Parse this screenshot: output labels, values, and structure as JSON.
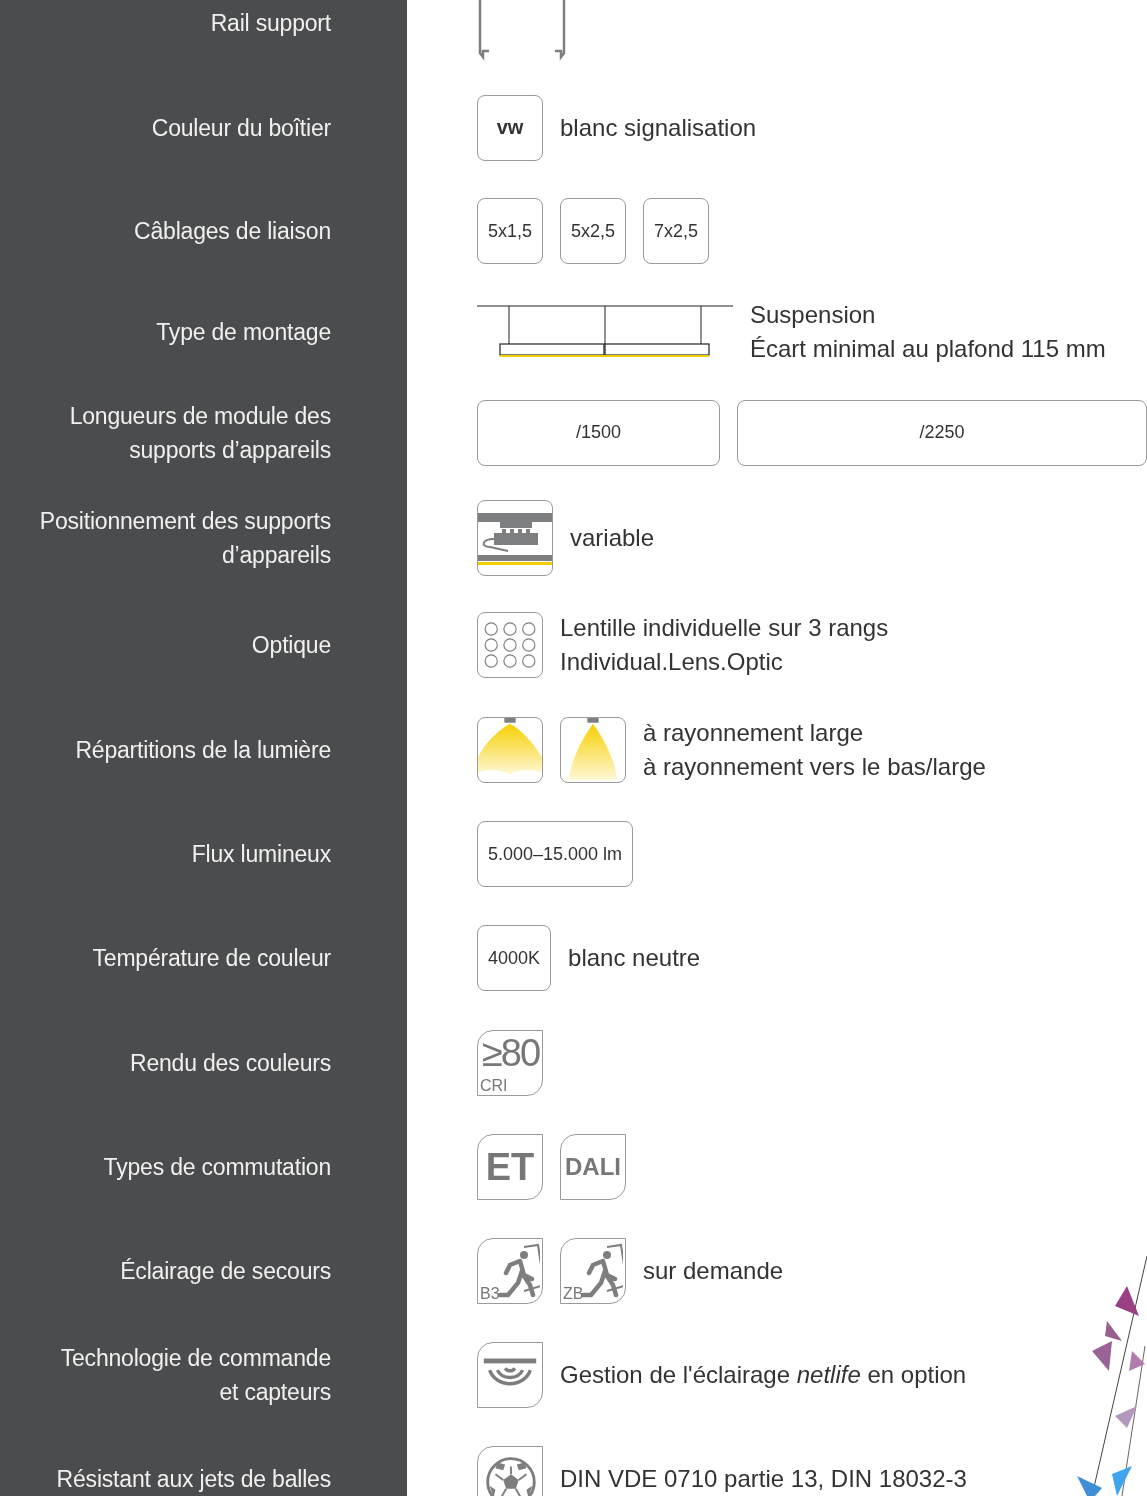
{
  "rows": [
    {
      "label": [
        "Rail support"
      ],
      "kind": "rail"
    },
    {
      "label": [
        "Couleur du boîtier"
      ],
      "kind": "badges",
      "badges": [
        {
          "text": "vw",
          "bold": true
        }
      ],
      "lines": [
        "blanc signalisation"
      ]
    },
    {
      "label": [
        "Câblages de liaison"
      ],
      "kind": "badges",
      "badges": [
        {
          "text": "5x1,5",
          "bold": false
        },
        {
          "text": "5x2,5",
          "bold": false
        },
        {
          "text": "7x2,5",
          "bold": false
        }
      ]
    },
    {
      "label": [
        "Type de montage"
      ],
      "kind": "suspension",
      "lines": [
        "Suspension",
        "Écart minimal au plafond 115 mm"
      ]
    },
    {
      "label": [
        "Longueurs de module des",
        "supports d’appareils"
      ],
      "kind": "wide",
      "badges": [
        {
          "text": "/1500",
          "bold": false
        },
        {
          "text": "/2250",
          "bold": false
        }
      ]
    },
    {
      "label": [
        "Positionnement des supports",
        "d’appareils"
      ],
      "kind": "icons",
      "icons": [
        {
          "kind": "mounting"
        }
      ],
      "lines": [
        "variable"
      ]
    },
    {
      "label": [
        "Optique"
      ],
      "kind": "icons",
      "icons": [
        {
          "kind": "lens"
        }
      ],
      "lines": [
        "Lentille individuelle sur 3 rangs",
        "Individual.Lens.Optic"
      ]
    },
    {
      "label": [
        "Répartitions de la lumière"
      ],
      "kind": "icons",
      "icons": [
        {
          "kind": "beam-wide"
        },
        {
          "kind": "beam-narrow"
        }
      ],
      "lines": [
        "à rayonnement large",
        "à rayonnement vers le bas/large"
      ]
    },
    {
      "label": [
        "Flux lumineux"
      ],
      "kind": "badges",
      "badges": [
        {
          "text": "5.000–15.000 lm",
          "bold": false
        }
      ]
    },
    {
      "label": [
        "Température de couleur"
      ],
      "kind": "badges",
      "badges": [
        {
          "text": "4000K",
          "bold": false
        }
      ],
      "lines": [
        "blanc neutre"
      ]
    },
    {
      "label": [
        "Rendu des couleurs"
      ],
      "kind": "icons",
      "icons": [
        {
          "kind": "cri",
          "text": "≥80",
          "sub": "CRI"
        }
      ]
    },
    {
      "label": [
        "Types de commutation"
      ],
      "kind": "icons",
      "icons": [
        {
          "kind": "logo",
          "text": "ET"
        },
        {
          "kind": "logo",
          "text": "DALI"
        }
      ]
    },
    {
      "label": [
        "Éclairage de secours"
      ],
      "kind": "icons",
      "icons": [
        {
          "kind": "exit",
          "sub": "B3"
        },
        {
          "kind": "exit",
          "sub": "ZB"
        }
      ],
      "lines": [
        "sur demande"
      ]
    },
    {
      "label": [
        "Technologie de commande",
        "et capteurs"
      ],
      "kind": "icons",
      "icons": [
        {
          "kind": "sensor"
        }
      ],
      "lines": [
        "Gestion de l'éclairage *netlife* en option"
      ]
    },
    {
      "label": [
        "Résistant aux jets de balles"
      ],
      "kind": "icons",
      "icons": [
        {
          "kind": "ball"
        }
      ],
      "lines": [
        "DIN VDE 0710 partie 13, DIN 18032-3"
      ]
    }
  ]
}
